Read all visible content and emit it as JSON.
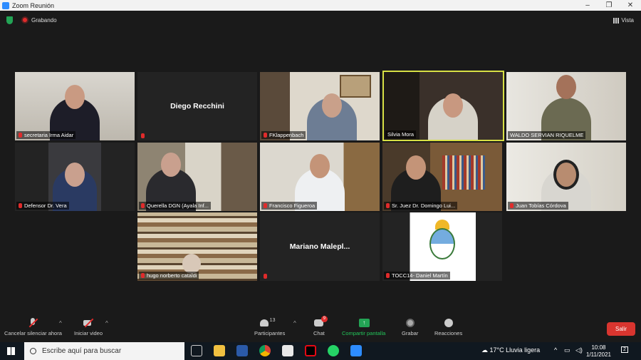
{
  "window": {
    "title": "Zoom Reunión",
    "controls": [
      "–",
      "❐",
      "✕"
    ]
  },
  "topbar": {
    "recording_label": "Grabando",
    "view_label": "Vista"
  },
  "participants": [
    {
      "name": "secretaria Irma Aidar",
      "camera": true,
      "active": false
    },
    {
      "name": "Diego Recchini",
      "camera": false,
      "active": false
    },
    {
      "name": "FKlappenbach",
      "camera": true,
      "active": false
    },
    {
      "name": "Silvia Mora",
      "camera": true,
      "active": true
    },
    {
      "name": "WALDO SERVIAN RIQUELME",
      "camera": true,
      "active": false
    },
    {
      "name": "Defensor Dr. Vera",
      "camera": true,
      "active": false
    },
    {
      "name": "Querella DGN (Ayala Inf...",
      "camera": true,
      "active": false
    },
    {
      "name": "Francisco Figueroa",
      "camera": true,
      "active": false
    },
    {
      "name": "Sr. Juez Dr. Domingo Lui...",
      "camera": true,
      "active": false
    },
    {
      "name": "Juan Tobías Córdova",
      "camera": true,
      "active": false
    },
    {
      "name": "hugo norberto cataldi",
      "camera": true,
      "active": false
    },
    {
      "name": "Mariano Malepl...",
      "camera": false,
      "active": false
    },
    {
      "name": "TOCC14- Daniel Martín",
      "camera": true,
      "active": false
    }
  ],
  "toolbar": {
    "mute_label": "Cancelar silenciar ahora",
    "video_label": "Iniciar video",
    "participants_label": "Participantes",
    "participants_count": "13",
    "chat_label": "Chat",
    "chat_badge": "9",
    "share_label": "Compartir pantalla",
    "record_label": "Grabar",
    "reactions_label": "Reacciones",
    "leave_label": "Salir"
  },
  "taskbar": {
    "search_placeholder": "Escribe aquí para buscar",
    "weather": "17°C  Lluvia ligera",
    "time": "10:08",
    "date": "1/11/2021",
    "notifications": "2"
  },
  "colors": {
    "accent": "#2d8cff",
    "active_border": "#d7e045",
    "leave": "#d9352f",
    "recording": "#e02b2b"
  }
}
